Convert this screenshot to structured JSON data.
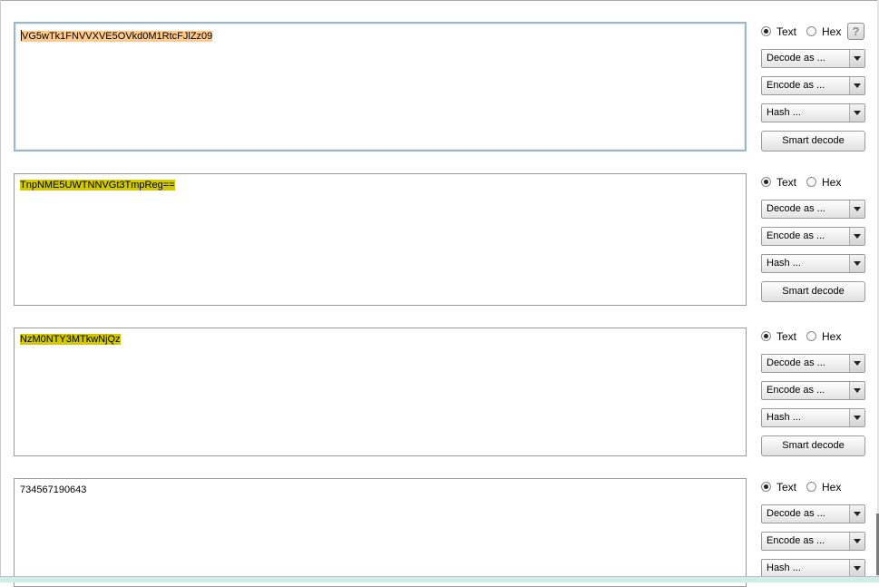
{
  "help_label": "?",
  "panels": [
    {
      "content": "VG5wTk1FNVVXVE5OVkd0M1RtcFJlZz09",
      "highlight": "#ffc98a",
      "radio_text": "Text",
      "radio_hex": "Hex",
      "decode_label": "Decode as ...",
      "encode_label": "Encode as ...",
      "hash_label": "Hash ...",
      "smart_label": "Smart decode"
    },
    {
      "content": "TnpNME5UWTNNVGt3TmpReg==",
      "highlight": "#d2c800",
      "radio_text": "Text",
      "radio_hex": "Hex",
      "decode_label": "Decode as ...",
      "encode_label": "Encode as ...",
      "hash_label": "Hash ...",
      "smart_label": "Smart decode"
    },
    {
      "content": "NzM0NTY3MTkwNjQz",
      "highlight": "#d2c800",
      "radio_text": "Text",
      "radio_hex": "Hex",
      "decode_label": "Decode as ...",
      "encode_label": "Encode as ...",
      "hash_label": "Hash ...",
      "smart_label": "Smart decode"
    },
    {
      "content": "734567190643",
      "highlight": "",
      "radio_text": "Text",
      "radio_hex": "Hex",
      "decode_label": "Decode as ...",
      "encode_label": "Encode as ...",
      "hash_label": "Hash ..."
    }
  ]
}
